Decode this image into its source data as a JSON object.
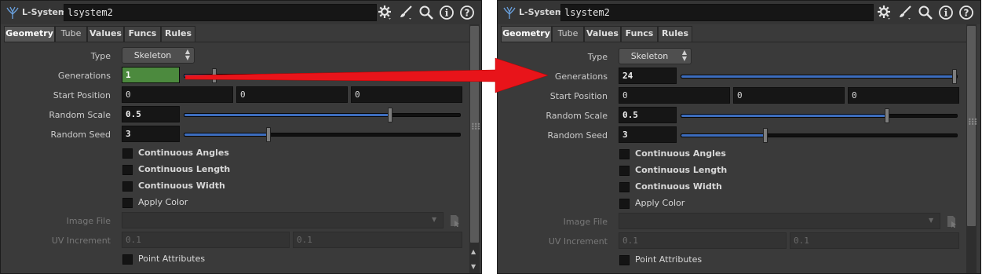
{
  "panels": [
    {
      "node_type": "L-System",
      "node_name": "lsystem2",
      "tabs": [
        "Geometry",
        "Tube",
        "Values",
        "Funcs",
        "Rules"
      ],
      "active_tab": "Geometry",
      "params": {
        "type_label": "Type",
        "type_value": "Skeleton",
        "generations_label": "Generations",
        "generations_value": "1",
        "generations_slider": 0.1,
        "start_position_label": "Start Position",
        "start_position": [
          "0",
          "0",
          "0"
        ],
        "random_scale_label": "Random Scale",
        "random_scale_value": "0.5",
        "random_scale_slider": 0.75,
        "random_seed_label": "Random Seed",
        "random_seed_value": "3",
        "random_seed_slider": 0.3,
        "checkboxes": [
          "Continuous Angles",
          "Continuous Length",
          "Continuous Width",
          "Apply Color"
        ],
        "image_file_label": "Image File",
        "image_file_value": "",
        "uv_increment_label": "UV Increment",
        "uv_increment": [
          "0.1",
          "0.1"
        ],
        "point_attributes_label": "Point Attributes"
      }
    },
    {
      "node_type": "L-System",
      "node_name": "lsystem2",
      "tabs": [
        "Geometry",
        "Tube",
        "Values",
        "Funcs",
        "Rules"
      ],
      "active_tab": "Geometry",
      "params": {
        "type_label": "Type",
        "type_value": "Skeleton",
        "generations_label": "Generations",
        "generations_value": "24",
        "generations_slider": 1.0,
        "start_position_label": "Start Position",
        "start_position": [
          "0",
          "0",
          "0"
        ],
        "random_scale_label": "Random Scale",
        "random_scale_value": "0.5",
        "random_scale_slider": 0.75,
        "random_seed_label": "Random Seed",
        "random_seed_value": "3",
        "random_seed_slider": 0.3,
        "checkboxes": [
          "Continuous Angles",
          "Continuous Length",
          "Continuous Width",
          "Apply Color"
        ],
        "image_file_label": "Image File",
        "image_file_value": "",
        "uv_increment_label": "UV Increment",
        "uv_increment": [
          "0.1",
          "0.1"
        ],
        "point_attributes_label": "Point Attributes"
      }
    }
  ],
  "toolbar_icons": [
    "gear-icon",
    "brush-icon",
    "search-icon",
    "info-icon",
    "help-icon"
  ],
  "annotation": {
    "shape": "red-arrow",
    "color": "#e8141a"
  },
  "colors": {
    "panel_bg": "#3a3a3a",
    "field_bg": "#161616",
    "slider_fill": "#3d6dbd",
    "highlight_field": "#4c8a3e",
    "arrow": "#e8141a"
  }
}
